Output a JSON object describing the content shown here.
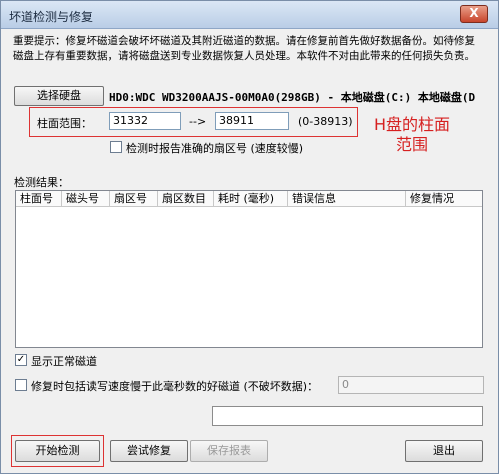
{
  "window": {
    "title": "坏道检测与修复",
    "close_label": "X"
  },
  "notice": {
    "text": "重要提示：修复坏磁道会破坏坏磁道及其附近磁道的数据。请在修复前首先做好数据备份。如待修复磁盘上存有重要数据，请将磁盘送到专业数据恢复人员处理。本软件不对由此带来的任何损失负责。"
  },
  "disk": {
    "select_label": "选择硬盘",
    "info": "HD0:WDC WD3200AAJS-00M0A0(298GB) - 本地磁盘(C:) 本地磁盘(D"
  },
  "cylinder_range": {
    "label": "柱面范围：",
    "start": "31332",
    "arrow": "-->",
    "end": "38911",
    "hint": "(0-38913)"
  },
  "annotation": {
    "text": "H盘的柱面范围"
  },
  "options": {
    "report_precise_sector": {
      "label": "检测时报告准确的扇区号 (速度较慢)",
      "checked": false
    },
    "show_normal_tracks": {
      "label": "显示正常磁道",
      "checked": true
    },
    "repair_slow_tracks": {
      "label": "修复时包括读写速度慢于此毫秒数的好磁道 (不破坏数据)：",
      "checked": false,
      "value": "0"
    }
  },
  "results": {
    "label": "检测结果：",
    "columns": [
      "柱面号",
      "磁头号",
      "扇区号",
      "扇区数目",
      "耗时 (毫秒)",
      "错误信息",
      "修复情况"
    ]
  },
  "buttons": {
    "start": "开始检测",
    "try_repair": "尝试修复",
    "save_report": "保存报表",
    "exit": "退出"
  }
}
